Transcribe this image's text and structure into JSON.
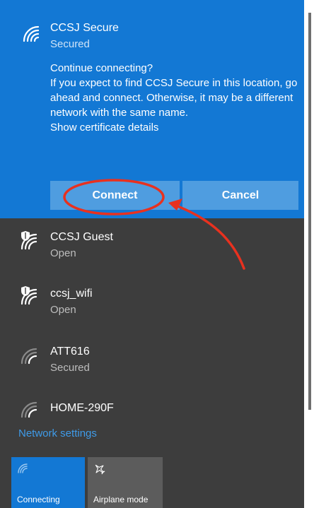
{
  "active_network": {
    "name": "CCSJ Secure",
    "status": "Secured",
    "prompt_title": "Continue connecting?",
    "prompt_body": "If you expect to find CCSJ Secure in this location, go ahead and connect. Otherwise, it may be a different network with the same name.",
    "cert_link": "Show certificate details",
    "connect_label": "Connect",
    "cancel_label": "Cancel"
  },
  "networks": [
    {
      "name": "CCSJ Guest",
      "status": "Open",
      "icon": "wifi-open-shield-icon"
    },
    {
      "name": "ccsj_wifi",
      "status": "Open",
      "icon": "wifi-open-shield-icon"
    },
    {
      "name": "ATT616",
      "status": "Secured",
      "icon": "wifi-weak-icon"
    },
    {
      "name": "HOME-290F",
      "status": "",
      "icon": "wifi-weak-icon"
    }
  ],
  "network_settings_label": "Network settings",
  "quick_actions": [
    {
      "label": "Connecting",
      "icon": "wifi-icon",
      "active": true
    },
    {
      "label": "Airplane mode",
      "icon": "airplane-icon",
      "active": false
    }
  ],
  "colors": {
    "accent": "#1378d4",
    "button": "#4f9de0",
    "flyout_bg": "#3d3d3d",
    "link": "#3f9be8",
    "annotation": "#e8311f"
  }
}
